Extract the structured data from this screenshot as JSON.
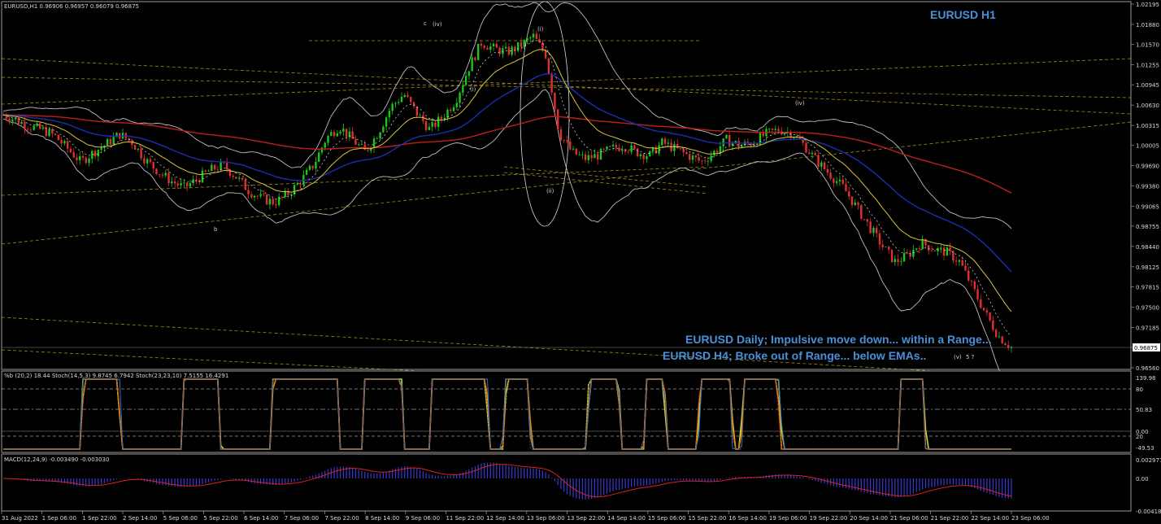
{
  "chart_data": {
    "type": "candlestick",
    "symbol_header": "EURUSD,H1  0.96906 0.96957 0.96079 0.96875",
    "title": "EURUSD H1",
    "annotations": [
      "EURUSD Daily; Impulsive move down... within a Range...",
      "EURUSD H4; Broke out of Range... below EMAs.."
    ],
    "wave_labels": [
      "c",
      "(iv)",
      "(i)",
      "(i)",
      "b",
      "(ii)",
      "(iv)",
      "(v)",
      "5 ?"
    ],
    "price_axis": [
      "1.02195",
      "1.01880",
      "1.01570",
      "1.01255",
      "1.00945",
      "1.00630",
      "1.00315",
      "1.00005",
      "0.99690",
      "0.99380",
      "0.99065",
      "0.98755",
      "0.98440",
      "0.98125",
      "0.97815",
      "0.97500",
      "0.97185",
      "0.96875",
      "0.96560"
    ],
    "current_price": "0.96875",
    "ylim": [
      0.9656,
      1.02195
    ],
    "time_axis": [
      "31 Aug 2022",
      "1 Sep 06:00",
      "1 Sep 22:00",
      "2 Sep 14:00",
      "5 Sep 06:00",
      "5 Sep 22:00",
      "6 Sep 14:00",
      "7 Sep 06:00",
      "7 Sep 22:00",
      "8 Sep 14:00",
      "9 Sep 06:00",
      "11 Sep 22:00",
      "12 Sep 14:00",
      "13 Sep 06:00",
      "13 Sep 22:00",
      "14 Sep 14:00",
      "15 Sep 06:00",
      "15 Sep 22:00",
      "16 Sep 14:00",
      "19 Sep 06:00",
      "19 Sep 22:00",
      "20 Sep 14:00",
      "21 Sep 06:00",
      "21 Sep 22:00",
      "22 Sep 14:00",
      "23 Sep 06:00"
    ],
    "close_path": [
      1.0048,
      1.004,
      1.003,
      1.0025,
      1.0015,
      0.9995,
      0.9975,
      0.999,
      1.0003,
      1.0018,
      1.0005,
      0.9978,
      0.996,
      0.9945,
      0.9935,
      0.9948,
      0.9962,
      0.997,
      0.9952,
      0.993,
      0.9918,
      0.9912,
      0.9925,
      0.9945,
      0.997,
      1.0012,
      1.003,
      1.001,
      0.999,
      1.002,
      1.006,
      1.008,
      1.005,
      1.0025,
      1.0045,
      1.007,
      1.012,
      1.016,
      1.015,
      1.0145,
      1.0155,
      1.017,
      1.014,
      1.002,
      0.999,
      0.998,
      0.9985,
      0.9995,
      1.0,
      0.999,
      0.9985,
      1.0005,
      0.9995,
      0.9985,
      0.9975,
      0.999,
      1.001,
      1.0,
      1.0005,
      1.0018,
      1.0025,
      1.002,
      1.0,
      0.9975,
      0.9955,
      0.9935,
      0.9905,
      0.9875,
      0.9845,
      0.982,
      0.983,
      0.985,
      0.984,
      0.9835,
      0.982,
      0.978,
      0.974,
      0.9705,
      0.9688
    ],
    "indicators": {
      "stoch_header": "%b (20,2) 18.44  Stoch(14,5,3) 9.8745 6.7942  Stoch(23,23,10) 7.5155 16.4291",
      "stoch_axis": [
        "139.98",
        "80",
        "50.83",
        "0.00",
        "20",
        "-49.53"
      ],
      "macd_header": "MACD(12,24,9) -0.003490 -0.003030",
      "macd_axis": [
        "0.002977",
        "0.00",
        "-0.004189"
      ]
    }
  }
}
